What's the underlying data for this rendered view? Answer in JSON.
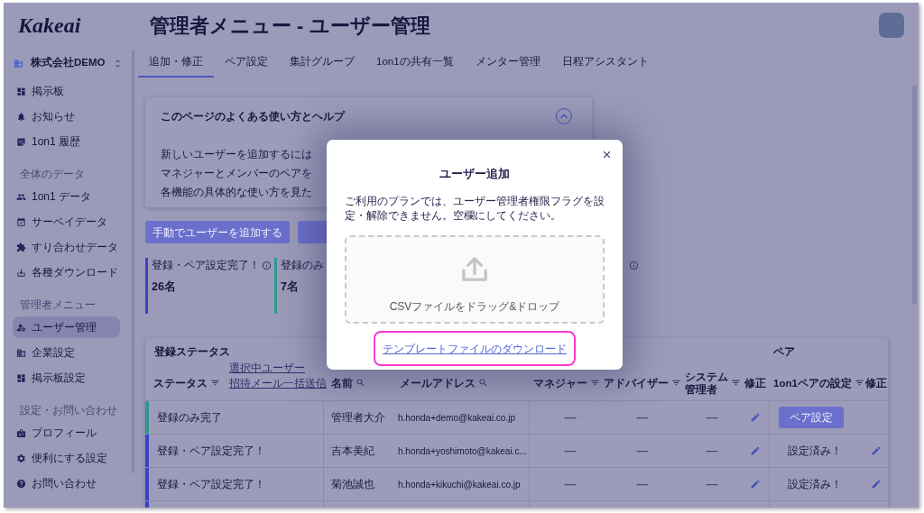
{
  "sidebar": {
    "logo": "Kakeai",
    "company": "株式会社DEMO",
    "sections": [
      {
        "items": [
          {
            "label": "掲示板",
            "selected": false
          },
          {
            "label": "お知らせ",
            "selected": false
          },
          {
            "label": "1on1 履歴",
            "selected": false
          }
        ]
      },
      {
        "heading": "全体のデータ",
        "items": [
          {
            "label": "1on1 データ",
            "selected": false
          },
          {
            "label": "サーベイデータ",
            "selected": false
          },
          {
            "label": "すり合わせデータ",
            "selected": false
          },
          {
            "label": "各種ダウンロード",
            "selected": false
          }
        ]
      },
      {
        "heading": "管理者メニュー",
        "items": [
          {
            "label": "ユーザー管理",
            "selected": true
          },
          {
            "label": "企業設定",
            "selected": false
          },
          {
            "label": "掲示板設定",
            "selected": false
          }
        ]
      },
      {
        "heading": "設定・お問い合わせ",
        "items": [
          {
            "label": "プロフィール",
            "selected": false
          },
          {
            "label": "便利にする設定",
            "selected": false
          },
          {
            "label": "お問い合わせ",
            "selected": false
          }
        ]
      }
    ]
  },
  "header": {
    "title": "管理者メニュー - ユーザー管理",
    "tabs": [
      {
        "label": "追加・修正",
        "selected": true
      },
      {
        "label": "ペア設定",
        "selected": false
      },
      {
        "label": "集計グループ",
        "selected": false
      },
      {
        "label": "1on1の共有一覧",
        "selected": false
      },
      {
        "label": "メンター管理",
        "selected": false
      },
      {
        "label": "日程アシスタント",
        "selected": false
      }
    ]
  },
  "help": {
    "title": "このページのよくある使い方とヘルプ",
    "expanded": true,
    "lines": [
      "新しいユーザーを追加するには",
      "マネジャーとメンバーのペアを",
      "各機能の具体的な使い方を見た"
    ]
  },
  "actions": {
    "buttons": [
      {
        "label": "手動でユーザーを追加する"
      }
    ]
  },
  "stats": [
    {
      "label": "登録・ペア設定完了！",
      "value": "26名",
      "color": "#3a43c6",
      "info": true
    },
    {
      "label": "登録のみ",
      "value": "7名",
      "color": "#2d998c",
      "info": false
    },
    {
      "info": true
    }
  ],
  "table": {
    "group_headers": [
      {
        "label": "登録ステータス"
      },
      {
        "label": "ペア"
      }
    ],
    "links": [
      "選択中ユーザー",
      "招待メール一括送信"
    ],
    "columns": [
      {
        "label": "ステータス",
        "kind": "filter"
      },
      {
        "label": "名前",
        "kind": "search"
      },
      {
        "label": "メールアドレス",
        "kind": "search"
      },
      {
        "label": "マネジャー",
        "kind": "filter"
      },
      {
        "label": "アドバイザー",
        "kind": "filter"
      },
      {
        "label": "システム管理者",
        "kind": "filter"
      },
      {
        "label": "修正",
        "kind": "plain"
      },
      {
        "label": "1on1ペアの設定",
        "kind": "filter"
      },
      {
        "label": "修正",
        "kind": "plain"
      }
    ],
    "rows": [
      {
        "color": "#2d998c",
        "status": "登録のみ完了",
        "name": "管理者大介",
        "email": "h.honda+demo@kakeai.co.jp",
        "manager": "—",
        "advisor": "—",
        "system_admin": "—",
        "pair": {
          "kind": "button",
          "label": "ペア設定"
        },
        "pair_edit": false
      },
      {
        "color": "#3a43c6",
        "status": "登録・ペア設定完了！",
        "name": "吉本美紀",
        "email": "h.honda+yoshimoto@kakeai.c...",
        "manager": "—",
        "advisor": "—",
        "system_admin": "—",
        "pair": {
          "kind": "text",
          "label": "設定済み！"
        },
        "pair_edit": true
      },
      {
        "color": "#3a43c6",
        "status": "登録・ペア設定完了！",
        "name": "菊池誠也",
        "email": "h.honda+kikuchi@kakeai.co.jp",
        "manager": "—",
        "advisor": "—",
        "system_admin": "—",
        "pair": {
          "kind": "text",
          "label": "設定済み！"
        },
        "pair_edit": true
      },
      {
        "color": "#3a43c6"
      }
    ]
  },
  "modal": {
    "title": "ユーザー追加",
    "note": "ご利用のプランでは、ユーザー管理者権限フラグを設定・解除できません。空欄にしてください。",
    "dropzone_label": "CSVファイルをドラッグ&ドロップ",
    "link": "テンプレートファイルのダウンロード",
    "link_highlighted": true
  }
}
